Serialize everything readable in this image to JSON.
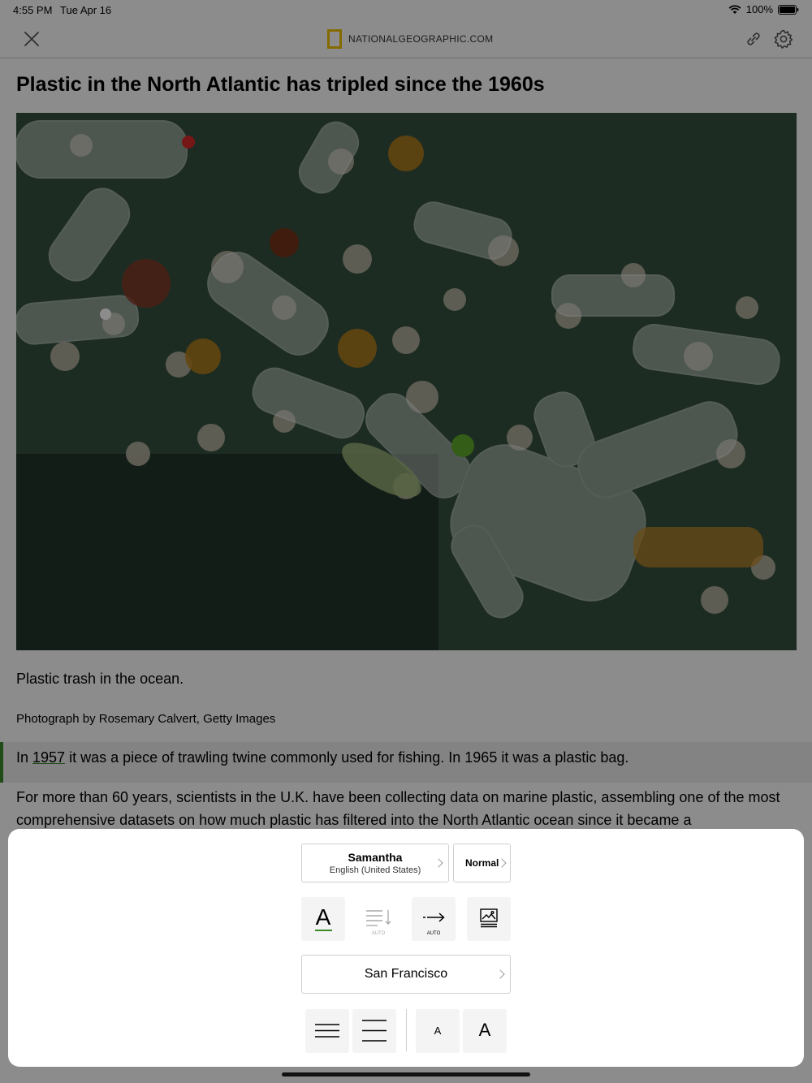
{
  "status_bar": {
    "time": "4:55 PM",
    "date": "Tue Apr 16",
    "battery": "100%"
  },
  "nav": {
    "source": "NATIONALGEOGRAPHIC.COM",
    "icons": [
      "close-icon",
      "natgeo-logo",
      "link-icon",
      "gear-icon"
    ]
  },
  "article": {
    "title": "Plastic in the North Atlantic has tripled since the 1960s",
    "image_alt": "Plastic trash in the ocean.",
    "caption": "Plastic trash in the ocean.",
    "credit": "Photograph by Rosemary Calvert, Getty Images",
    "paragraph_1": {
      "before": "In ",
      "year_link": "1957",
      "after": " it was a piece of trawling twine commonly used for fishing. In 1965 it was a plastic bag."
    },
    "paragraph_2": "For more than 60 years, scientists in the U.K. have been collecting data on marine plastic, assembling one of the most comprehensive datasets on how much plastic has filtered into the North Atlantic ocean since it became a"
  },
  "sheet": {
    "voice": {
      "name": "Samantha",
      "language": "English (United States)"
    },
    "speed": "Normal",
    "tools": {
      "font_color_glyph": "A",
      "scroll_auto_tag": "AUTO",
      "advance_auto_tag": "AUTO"
    },
    "font": "San Francisco",
    "text_size": {
      "small": "A",
      "large": "A"
    },
    "colors": {
      "accent_green": "#3a8a2a",
      "brand_yellow": "#f2c200"
    }
  }
}
